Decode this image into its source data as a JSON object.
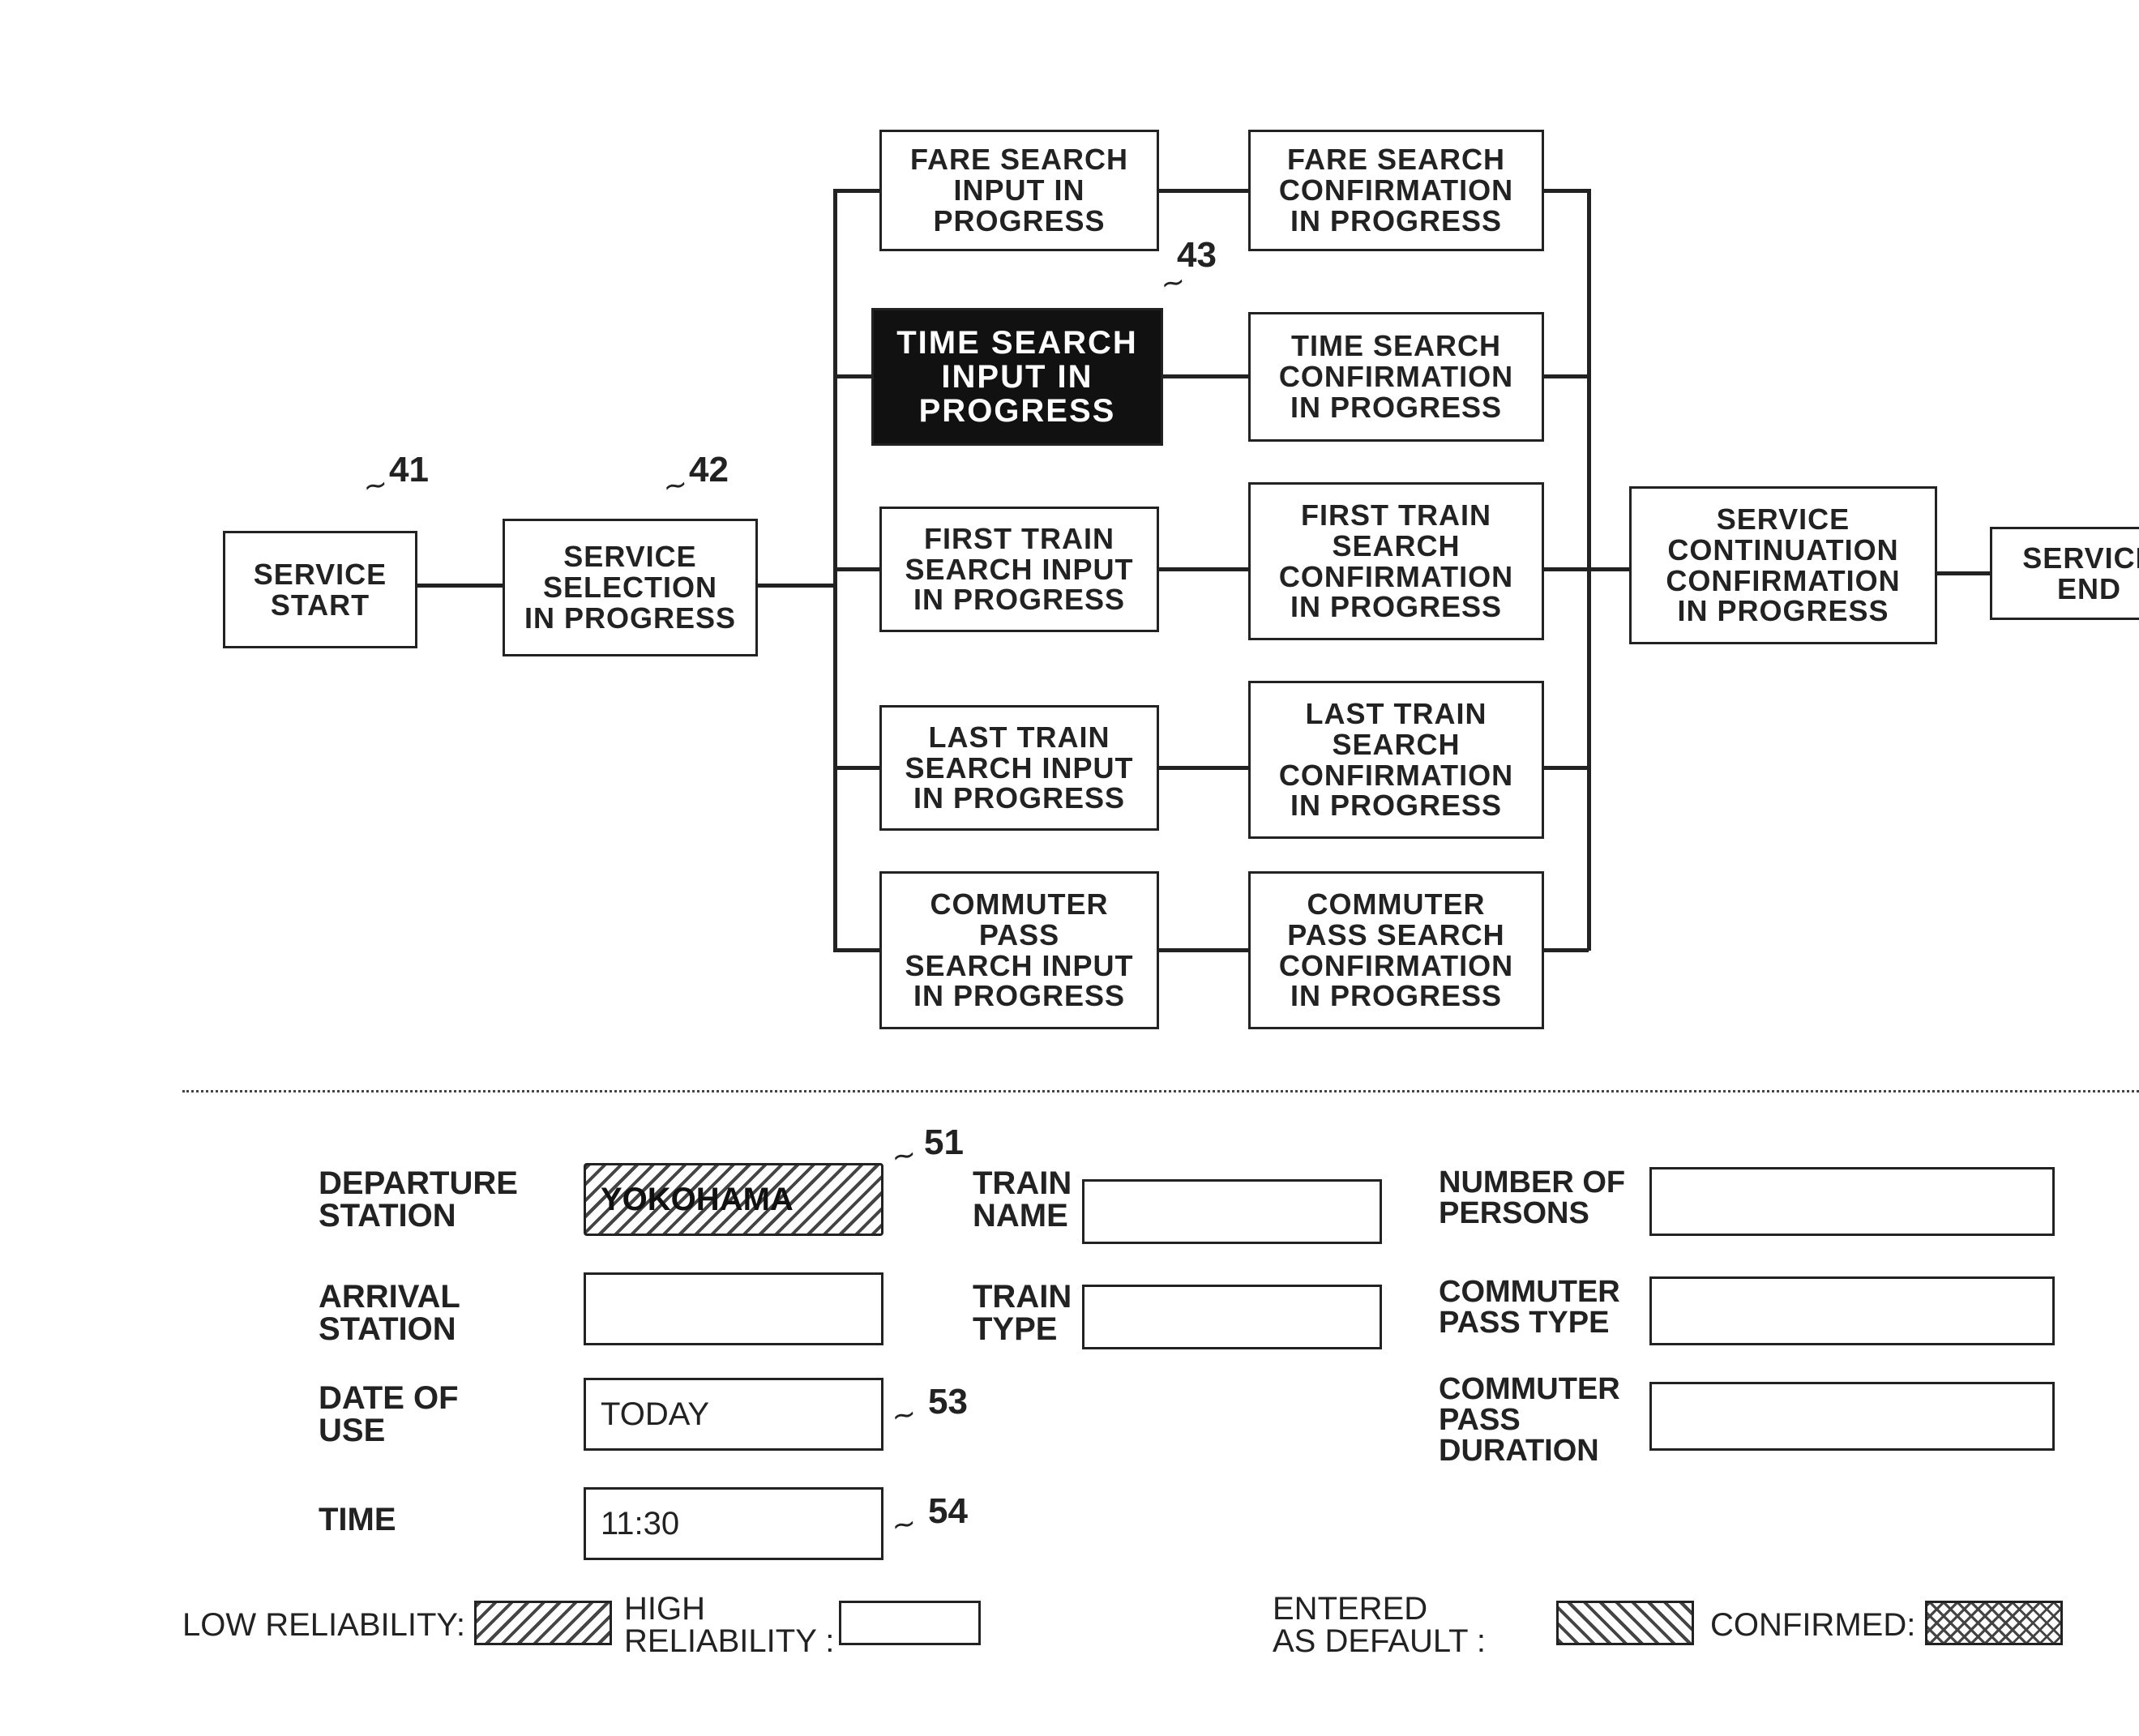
{
  "flow": {
    "service_start": "SERVICE\nSTART",
    "service_selection": "SERVICE\nSELECTION\nIN PROGRESS",
    "fare_input": "FARE SEARCH\nINPUT IN\nPROGRESS",
    "fare_confirm": "FARE SEARCH\nCONFIRMATION\nIN PROGRESS",
    "time_input": "TIME SEARCH\nINPUT IN\nPROGRESS",
    "time_confirm": "TIME SEARCH\nCONFIRMATION\nIN PROGRESS",
    "first_input": "FIRST TRAIN\nSEARCH INPUT\nIN PROGRESS",
    "first_confirm": "FIRST TRAIN\nSEARCH\nCONFIRMATION\nIN PROGRESS",
    "last_input": "LAST TRAIN\nSEARCH INPUT\nIN PROGRESS",
    "last_confirm": "LAST TRAIN\nSEARCH\nCONFIRMATION\nIN PROGRESS",
    "commuter_input": "COMMUTER\nPASS\nSEARCH INPUT\nIN PROGRESS",
    "commuter_confirm": "COMMUTER\nPASS SEARCH\nCONFIRMATION\nIN PROGRESS",
    "service_continuation": "SERVICE\nCONTINUATION\nCONFIRMATION\nIN PROGRESS",
    "service_end": "SERVICE\nEND"
  },
  "refs": {
    "r41": "41",
    "r42": "42",
    "r43": "43",
    "r51": "51",
    "r53": "53",
    "r54": "54"
  },
  "form": {
    "labels": {
      "departure_station": "DEPARTURE\nSTATION",
      "arrival_station": "ARRIVAL\nSTATION",
      "date_of_use": "DATE OF\nUSE",
      "time": "TIME",
      "train_name": "TRAIN\nNAME",
      "train_type": "TRAIN\nTYPE",
      "number_of_persons": "NUMBER OF\nPERSONS",
      "commuter_pass_type": "COMMUTER\nPASS TYPE",
      "commuter_pass_duration": "COMMUTER\nPASS\nDURATION"
    },
    "values": {
      "departure_station": "YOKOHAMA",
      "arrival_station": "",
      "date_of_use": "TODAY",
      "time": "11:30",
      "train_name": "",
      "train_type": "",
      "number_of_persons": "",
      "commuter_pass_type": "",
      "commuter_pass_duration": ""
    }
  },
  "legend": {
    "low_reliability": "LOW RELIABILITY:",
    "high_reliability": "HIGH\nRELIABILITY :",
    "entered_default": "ENTERED\nAS DEFAULT :",
    "confirmed": "CONFIRMED:"
  }
}
